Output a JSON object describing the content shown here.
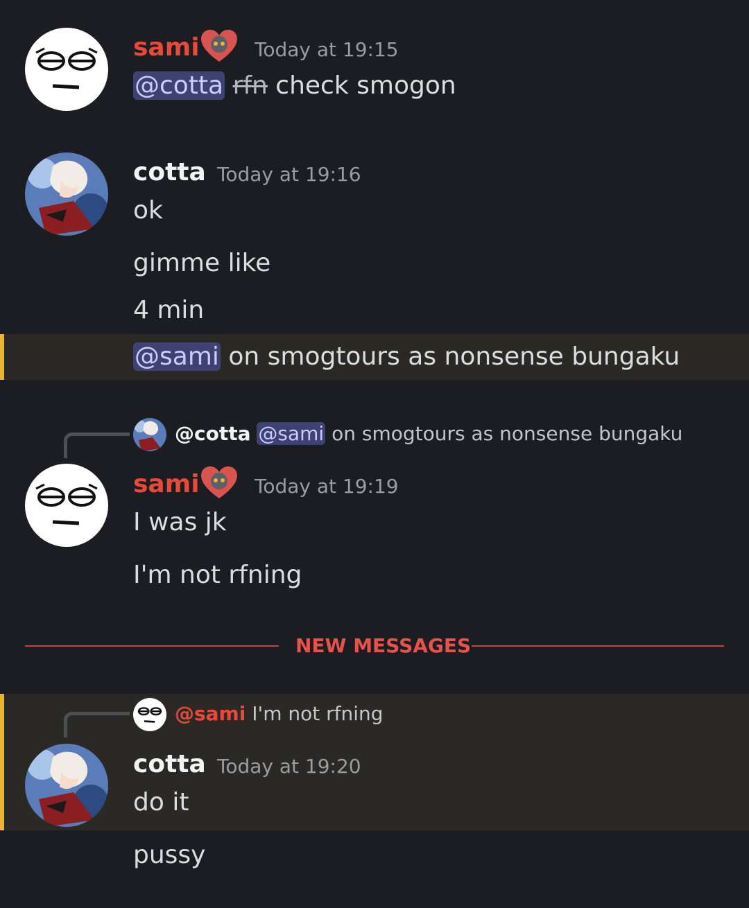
{
  "messages": {
    "m1": {
      "author": "sami",
      "timestamp": "Today at 19:15",
      "mention": "@cotta",
      "strikethrough": "rfn",
      "text": " check smogon"
    },
    "m2": {
      "author": "cotta",
      "timestamp": "Today at 19:16",
      "line1": "ok",
      "line2": "gimme like",
      "line3": "4 min",
      "line4_mention": "@sami",
      "line4_text": " on smogtours as nonsense bungaku"
    },
    "m3": {
      "reply_to": "@cotta",
      "reply_mention": "@sami",
      "reply_text": " on smogtours as nonsense bungaku",
      "author": "sami",
      "timestamp": "Today at 19:19",
      "line1": "I was jk",
      "line2": "I'm not rfning"
    },
    "divider": {
      "label": "NEW MESSAGES"
    },
    "m4": {
      "reply_to": "@sami",
      "reply_text": " I'm not rfning",
      "author": "cotta",
      "timestamp": "Today at 19:20",
      "line1": "do it",
      "line2": "pussy"
    }
  },
  "colors": {
    "background": "#1c1d22",
    "highlight": "#2a2925",
    "highlight_bar": "#f0b232",
    "sami_name": "#e84a3a",
    "mention_bg": "#3d4270",
    "new_messages": "#e5534b"
  },
  "icons": {
    "sami_avatar": "meme-face-avatar",
    "cotta_avatar": "anime-character-avatar",
    "badge": "heart-creature-badge"
  }
}
